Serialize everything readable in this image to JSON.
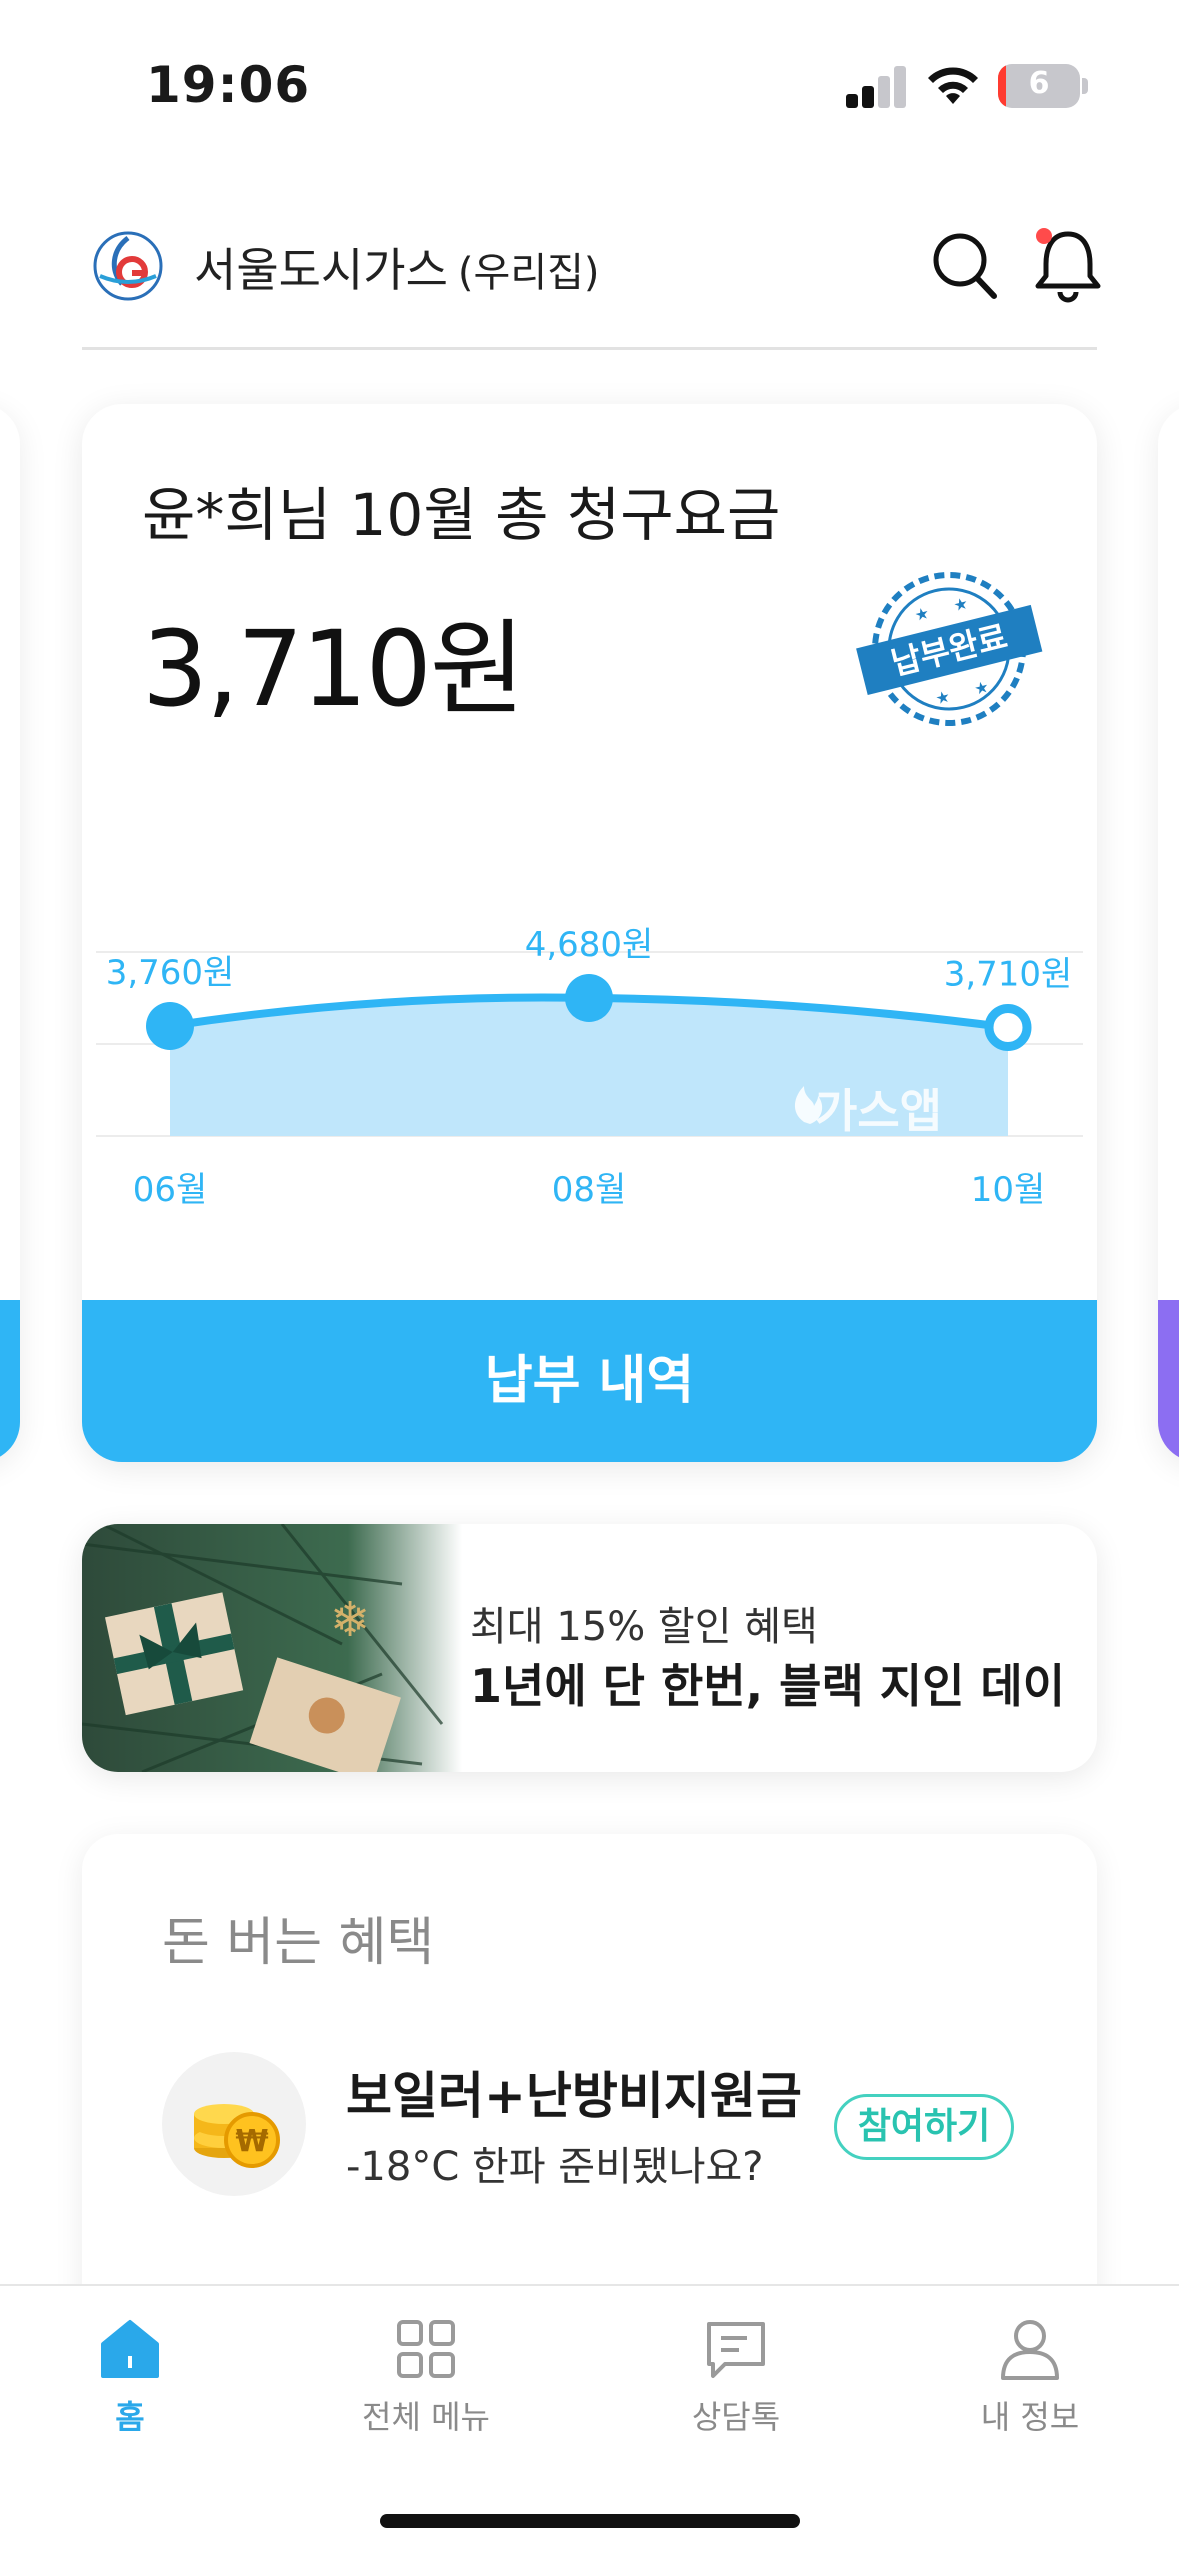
{
  "status_bar": {
    "time": "19:06",
    "battery": "6",
    "icons": [
      "signal-icon",
      "wifi-icon",
      "battery-icon"
    ]
  },
  "header": {
    "company": "서울도시가스",
    "place": "(우리집)",
    "icons": [
      "company-logo",
      "search-icon",
      "bell-icon"
    ],
    "notification_dot_color": "#ff4b4b"
  },
  "bill": {
    "title": "윤*희님 10월 총 청구요금",
    "amount": "3,710원",
    "stamp_text": "납부완료",
    "watermark": "가스앱",
    "pay_history_label": "납부 내역"
  },
  "chart_data": {
    "type": "area",
    "categories": [
      "06월",
      "08월",
      "10월"
    ],
    "values": [
      3760,
      4680,
      3710
    ],
    "data_labels": [
      "3,760원",
      "4,680원",
      "3,710원"
    ],
    "title": "",
    "xlabel": "",
    "ylabel": "",
    "grid": true,
    "colors": {
      "line": "#2fb5f5",
      "fill": "#bfe6fb"
    }
  },
  "banner": {
    "subtitle": "최대 15% 할인 혜택",
    "title": "1년에 단 한번, 블랙 지인 데이"
  },
  "benefits": {
    "heading": "돈 버는 혜택",
    "item": {
      "icon": "coin-stack-icon",
      "title": "보일러+난방비지원금",
      "desc": "-18°C 한파 준비됐나요?",
      "button": "참여하기"
    }
  },
  "bottom_nav": {
    "items": [
      {
        "label": "홈",
        "icon": "home-icon",
        "active": true
      },
      {
        "label": "전체 메뉴",
        "icon": "grid-icon",
        "active": false
      },
      {
        "label": "상담톡",
        "icon": "chat-icon",
        "active": false
      },
      {
        "label": "내 정보",
        "icon": "person-icon",
        "active": false
      }
    ],
    "active_color": "#2aa8ea"
  }
}
